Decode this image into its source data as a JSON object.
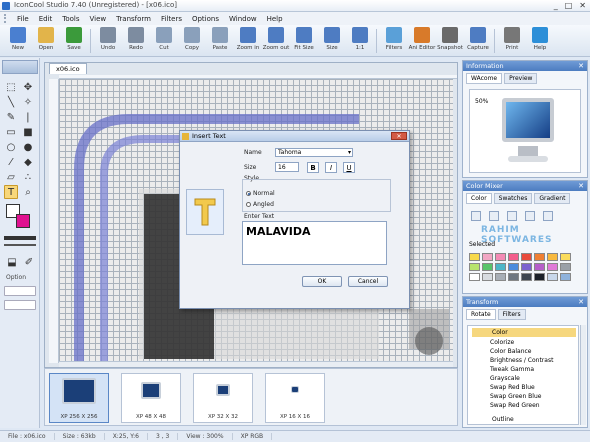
{
  "window": {
    "title": "IconCool Studio 7.40 (Unregistered) - [x06.ico]",
    "buttons": [
      "_",
      "□",
      "✕"
    ]
  },
  "menu": [
    "File",
    "Edit",
    "Tools",
    "View",
    "Transform",
    "Filters",
    "Options",
    "Window",
    "Help"
  ],
  "toolbar": [
    {
      "label": "New",
      "icon": "new-file-icon",
      "color": "#4a7fd0"
    },
    {
      "label": "Open",
      "icon": "open-folder-icon",
      "color": "#e2b44a"
    },
    {
      "label": "Save",
      "icon": "save-icon",
      "color": "#3b9a3b"
    },
    {
      "label": "Undo",
      "icon": "undo-icon",
      "color": "#7d8ca0"
    },
    {
      "label": "Redo",
      "icon": "redo-icon",
      "color": "#7d8ca0"
    },
    {
      "label": "Cut",
      "icon": "cut-icon",
      "color": "#8aa0bb"
    },
    {
      "label": "Copy",
      "icon": "copy-icon",
      "color": "#8aa0bb"
    },
    {
      "label": "Paste",
      "icon": "paste-icon",
      "color": "#8aa0bb"
    },
    {
      "label": "Zoom in",
      "icon": "zoom-in-icon",
      "color": "#4e7cc2"
    },
    {
      "label": "Zoom out",
      "icon": "zoom-out-icon",
      "color": "#4e7cc2"
    },
    {
      "label": "Fit Size",
      "icon": "fit-size-icon",
      "color": "#4e7cc2"
    },
    {
      "label": "Size",
      "icon": "size-icon",
      "color": "#4e7cc2"
    },
    {
      "label": "1:1",
      "icon": "actual-size-icon",
      "color": "#4e7cc2"
    },
    {
      "label": "Filters",
      "icon": "filters-icon",
      "color": "#5aa0d8"
    },
    {
      "label": "Ani Editor",
      "icon": "animation-editor-icon",
      "color": "#d87a2a"
    },
    {
      "label": "Snapshot",
      "icon": "snapshot-icon",
      "color": "#6a6a6a"
    },
    {
      "label": "Capture",
      "icon": "capture-icon",
      "color": "#4e7cc2"
    },
    {
      "label": "Print",
      "icon": "print-icon",
      "color": "#777"
    },
    {
      "label": "Help",
      "icon": "help-icon",
      "color": "#2d8fd8"
    }
  ],
  "document": {
    "tab": "x06.ico"
  },
  "thumbnails": [
    {
      "label": "XP 256 X 256",
      "selected": true
    },
    {
      "label": "XP 48 X 48",
      "selected": false
    },
    {
      "label": "XP 32 X 32",
      "selected": false
    },
    {
      "label": "XP 16 X 16",
      "selected": false
    }
  ],
  "dialog": {
    "title": "Insert Text",
    "name_label": "Name",
    "font": "Tahoma",
    "size_label": "Size",
    "size": "16",
    "bold": "B",
    "italic": "I",
    "underline": "U",
    "style_label": "Style",
    "normal": "Normal",
    "angled": "Angled",
    "enter_text_label": "Enter Text",
    "text": "MALAVIDA",
    "ok": "OK",
    "cancel": "Cancel"
  },
  "info_panel": {
    "title": "Information",
    "tabs": [
      "WAcome",
      "Preview"
    ],
    "zoom": "50%"
  },
  "color_mixer": {
    "title": "Color Mixer",
    "tabs": [
      "Color",
      "Swatches",
      "Gradient"
    ],
    "selected_label": "Selected",
    "watermark": "RAHIM SOFTWARES",
    "swatches": [
      "#f7d94a",
      "#f2a7c4",
      "#f48bb5",
      "#f25d8b",
      "#e94b3c",
      "#f07f33",
      "#f8b93f",
      "#fadc5c",
      "#b7e36d",
      "#58c46b",
      "#4db6c8",
      "#4a8bdc",
      "#7a62cf",
      "#b65fc9",
      "#e07bd8",
      "#9aa0a8",
      "#ffffff",
      "#d7dbe0",
      "#a8aeb6",
      "#6e7680",
      "#3e4650",
      "#1b2028",
      "#c8d7ea",
      "#8fb2dc"
    ]
  },
  "transform": {
    "title": "Transform",
    "tabs": [
      "Rotate",
      "Filters"
    ],
    "group": "Color",
    "items": [
      "Colorize",
      "Color Balance",
      "Brightness / Contrast",
      "Tweak Gamma",
      "Grayscale",
      "Swap Red Blue",
      "Swap Green Blue",
      "Swap Red Green"
    ],
    "group2": "Outline"
  },
  "status": {
    "file": "File : x06.ico",
    "size": "Size : 63kb",
    "coords": "X:25, Y:6",
    "pixel": "3 , 3",
    "view": "View : 300%",
    "mode": "XP RGB"
  }
}
